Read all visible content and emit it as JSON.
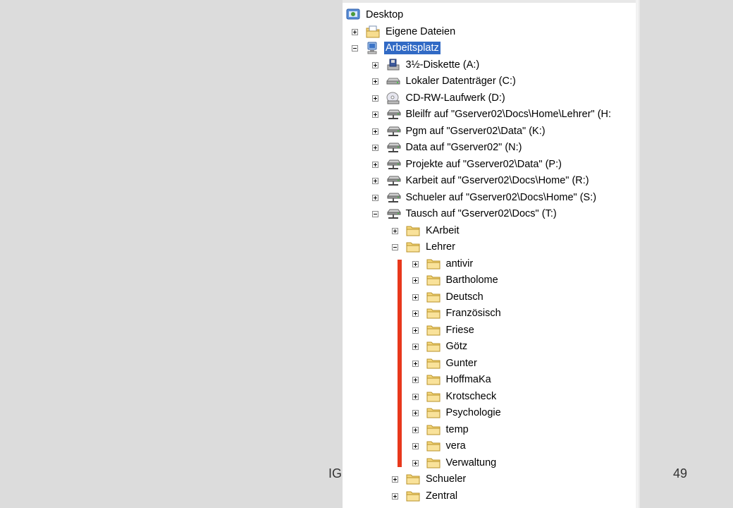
{
  "slide": {
    "footer_left": "IG",
    "page_number": "49",
    "accent_bar_color": "#e8381c"
  },
  "tree": {
    "selection_color": "#316ac5",
    "nodes": [
      {
        "label": "Desktop",
        "icon": "desktop-icon",
        "level": 0,
        "toggle": "none",
        "selected": false
      },
      {
        "label": "Eigene Dateien",
        "icon": "my-documents-icon",
        "level": 1,
        "toggle": "plus",
        "selected": false
      },
      {
        "label": "Arbeitsplatz",
        "icon": "my-computer-icon",
        "level": 1,
        "toggle": "minus",
        "selected": true
      },
      {
        "label": "3½-Diskette (A:)",
        "icon": "floppy-drive-icon",
        "level": 2,
        "toggle": "plus",
        "selected": false
      },
      {
        "label": "Lokaler Datenträger (C:)",
        "icon": "hard-disk-icon",
        "level": 2,
        "toggle": "plus",
        "selected": false
      },
      {
        "label": "CD-RW-Laufwerk (D:)",
        "icon": "cd-drive-icon",
        "level": 2,
        "toggle": "plus",
        "selected": false
      },
      {
        "label": "Bleilfr auf \"Gserver02\\Docs\\Home\\Lehrer\" (H:",
        "icon": "network-drive-icon",
        "level": 2,
        "toggle": "plus",
        "selected": false
      },
      {
        "label": "Pgm auf \"Gserver02\\Data\" (K:)",
        "icon": "network-drive-icon",
        "level": 2,
        "toggle": "plus",
        "selected": false
      },
      {
        "label": "Data auf \"Gserver02\" (N:)",
        "icon": "network-drive-icon",
        "level": 2,
        "toggle": "plus",
        "selected": false
      },
      {
        "label": "Projekte auf \"Gserver02\\Data\" (P:)",
        "icon": "network-drive-icon",
        "level": 2,
        "toggle": "plus",
        "selected": false
      },
      {
        "label": "Karbeit auf \"Gserver02\\Docs\\Home\" (R:)",
        "icon": "network-drive-icon",
        "level": 2,
        "toggle": "plus",
        "selected": false
      },
      {
        "label": "Schueler auf \"Gserver02\\Docs\\Home\" (S:)",
        "icon": "network-drive-icon",
        "level": 2,
        "toggle": "plus",
        "selected": false
      },
      {
        "label": "Tausch auf \"Gserver02\\Docs\" (T:)",
        "icon": "network-drive-icon",
        "level": 2,
        "toggle": "minus",
        "selected": false
      },
      {
        "label": "KArbeit",
        "icon": "folder-icon",
        "level": 3,
        "toggle": "plus",
        "selected": false
      },
      {
        "label": "Lehrer",
        "icon": "folder-icon",
        "level": 3,
        "toggle": "minus",
        "selected": false
      },
      {
        "label": "antivir",
        "icon": "folder-icon",
        "level": 4,
        "toggle": "plus",
        "selected": false
      },
      {
        "label": "Bartholome",
        "icon": "folder-icon",
        "level": 4,
        "toggle": "plus",
        "selected": false
      },
      {
        "label": "Deutsch",
        "icon": "folder-icon",
        "level": 4,
        "toggle": "plus",
        "selected": false
      },
      {
        "label": "Französisch",
        "icon": "folder-icon",
        "level": 4,
        "toggle": "plus",
        "selected": false
      },
      {
        "label": "Friese",
        "icon": "folder-icon",
        "level": 4,
        "toggle": "plus",
        "selected": false
      },
      {
        "label": "Götz",
        "icon": "folder-icon",
        "level": 4,
        "toggle": "plus",
        "selected": false
      },
      {
        "label": "Gunter",
        "icon": "folder-icon",
        "level": 4,
        "toggle": "plus",
        "selected": false
      },
      {
        "label": "HoffmaKa",
        "icon": "folder-icon",
        "level": 4,
        "toggle": "plus",
        "selected": false
      },
      {
        "label": "Krotscheck",
        "icon": "folder-icon",
        "level": 4,
        "toggle": "plus",
        "selected": false
      },
      {
        "label": "Psychologie",
        "icon": "folder-icon",
        "level": 4,
        "toggle": "plus",
        "selected": false
      },
      {
        "label": "temp",
        "icon": "folder-icon",
        "level": 4,
        "toggle": "plus",
        "selected": false
      },
      {
        "label": "vera",
        "icon": "folder-icon",
        "level": 4,
        "toggle": "plus",
        "selected": false
      },
      {
        "label": "Verwaltung",
        "icon": "folder-icon",
        "level": 4,
        "toggle": "plus",
        "selected": false
      },
      {
        "label": "Schueler",
        "icon": "folder-icon",
        "level": 3,
        "toggle": "plus",
        "selected": false
      },
      {
        "label": "Zentral",
        "icon": "folder-icon",
        "level": 3,
        "toggle": "plus",
        "selected": false
      }
    ]
  }
}
